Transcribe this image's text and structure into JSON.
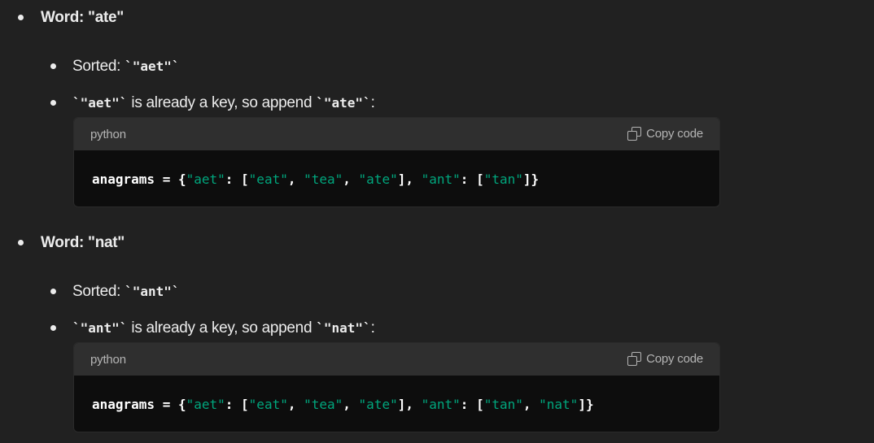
{
  "steps": [
    {
      "word_line": "Word: \"ate\"",
      "sorted_prefix": "Sorted: ",
      "sorted_code": "`\"aet\"`",
      "action_code": "`\"aet\"`",
      "action_text": " is already a key, so append ",
      "action_code2": "`\"ate\"`",
      "action_suffix": ":",
      "code": {
        "language": "python",
        "copy_label": "Copy code",
        "line": "anagrams = {\"aet\": [\"eat\", \"tea\", \"ate\"], \"ant\": [\"tan\"]}"
      }
    },
    {
      "word_line": "Word: \"nat\"",
      "sorted_prefix": "Sorted: ",
      "sorted_code": "`\"ant\"`",
      "action_code": "`\"ant\"`",
      "action_text": " is already a key, so append ",
      "action_code2": "`\"nat\"`",
      "action_suffix": ":",
      "code": {
        "language": "python",
        "copy_label": "Copy code",
        "line": "anagrams = {\"aet\": [\"eat\", \"tea\", \"ate\"], \"ant\": [\"tan\", \"nat\"]}"
      }
    }
  ],
  "colors": {
    "background": "#212121",
    "code_background": "#0d0d0d",
    "code_header": "#2f2f2f",
    "string": "#00a67d",
    "text": "#ececec"
  },
  "icons": {
    "copy": "copy-icon"
  }
}
